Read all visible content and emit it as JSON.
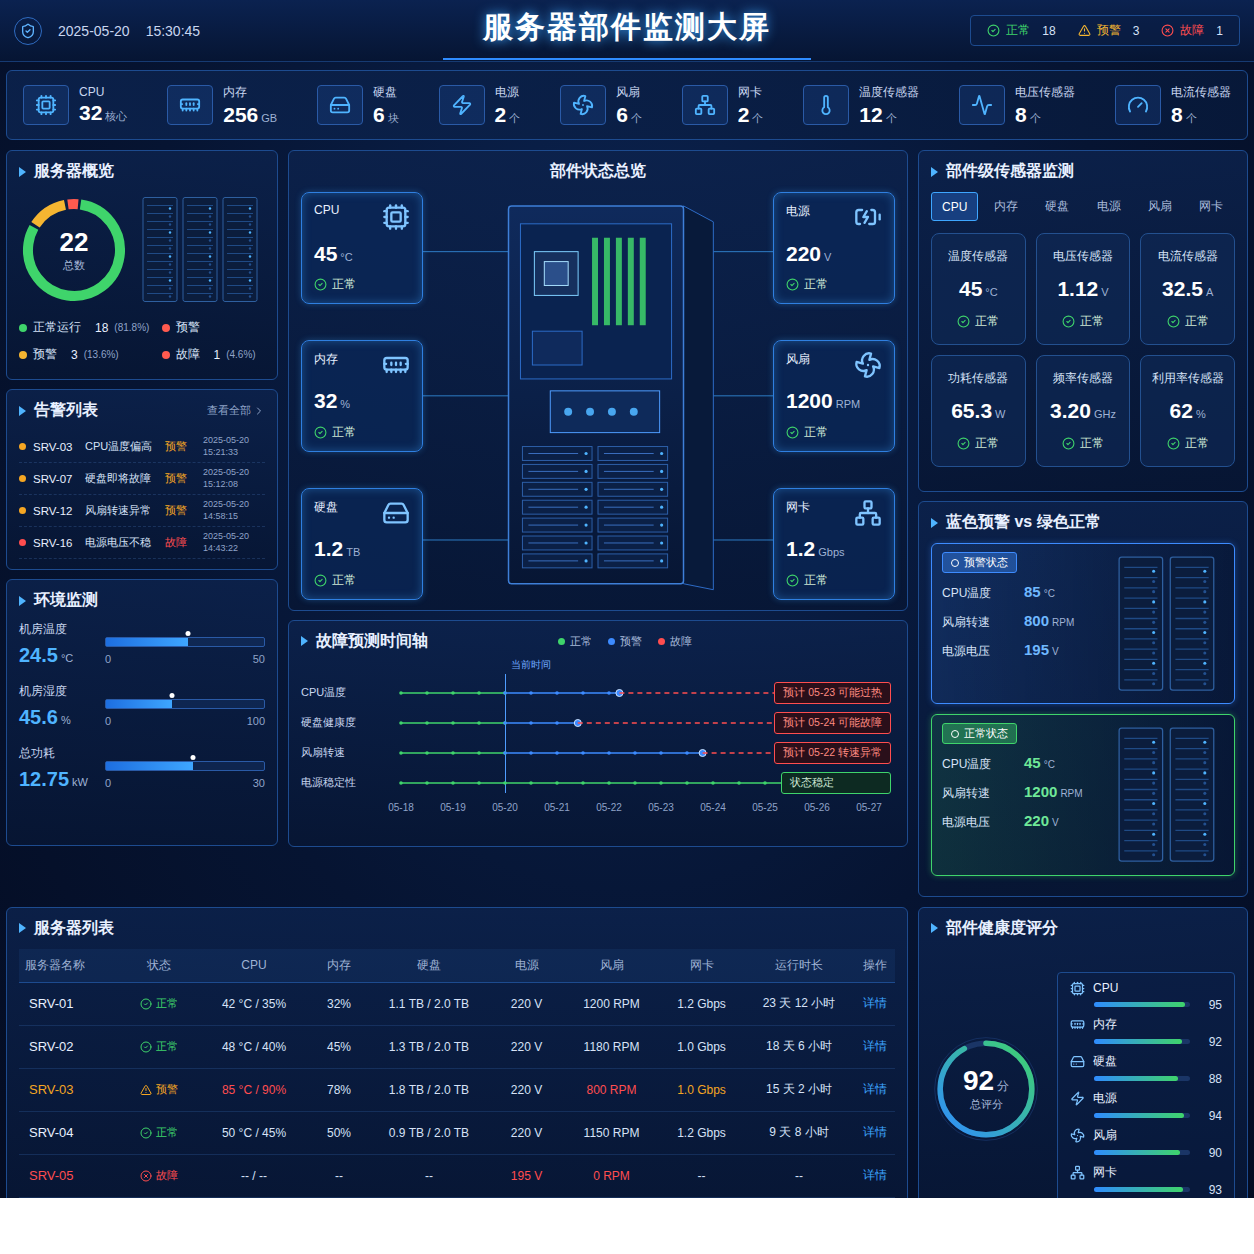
{
  "header": {
    "date": "2025-05-20",
    "time": "15:30:45",
    "title": "服务器部件监测大屏",
    "status": [
      {
        "label": "正常",
        "count": "18",
        "kind": "normal",
        "color": "#3fd46b"
      },
      {
        "label": "预警",
        "count": "3",
        "kind": "warning",
        "color": "#f5b531"
      },
      {
        "label": "故障",
        "count": "1",
        "kind": "fault",
        "color": "#ff4d4f"
      }
    ]
  },
  "stats": [
    {
      "kind": "cpu",
      "label": "CPU",
      "value": "32",
      "unit": "核心"
    },
    {
      "kind": "memory",
      "label": "内存",
      "value": "256",
      "unit": "GB"
    },
    {
      "kind": "disk",
      "label": "硬盘",
      "value": "6",
      "unit": "块"
    },
    {
      "kind": "power",
      "label": "电源",
      "value": "2",
      "unit": "个"
    },
    {
      "kind": "fan",
      "label": "风扇",
      "value": "6",
      "unit": "个"
    },
    {
      "kind": "nic",
      "label": "网卡",
      "value": "2",
      "unit": "个"
    },
    {
      "kind": "temp",
      "label": "温度传感器",
      "value": "12",
      "unit": "个"
    },
    {
      "kind": "volt",
      "label": "电压传感器",
      "value": "8",
      "unit": "个"
    },
    {
      "kind": "current",
      "label": "电流传感器",
      "value": "8",
      "unit": "个"
    }
  ],
  "overview": {
    "title": "服务器概览",
    "total": "22",
    "total_label": "总数",
    "segments": [
      {
        "value": 18,
        "color": "#3fd46b"
      },
      {
        "value": 3,
        "color": "#f5b531"
      },
      {
        "value": 1,
        "color": "#ff5a4f"
      }
    ],
    "legend": [
      {
        "label": "正常运行",
        "count": "18",
        "pct": "(81.8%)",
        "color": "#3fd46b"
      },
      {
        "label": "预警",
        "color": "#ff5a4f"
      },
      {
        "label": "预警",
        "count": "3",
        "pct": "(13.6%)",
        "color": "#f5b531"
      },
      {
        "label": "故障",
        "count": "1",
        "pct": "(4.6%)",
        "color": "#ff5a4f"
      }
    ]
  },
  "alarms": {
    "title": "告警列表",
    "view_all": "查看全部",
    "items": [
      {
        "server": "SRV-03",
        "message": "CPU温度偏高",
        "level": "预警",
        "date": "2025-05-20",
        "time": "15:21:33",
        "color": "#f5a623"
      },
      {
        "server": "SRV-07",
        "message": "硬盘即将故障",
        "level": "预警",
        "date": "2025-05-20",
        "time": "15:12:08",
        "color": "#f5a623"
      },
      {
        "server": "SRV-12",
        "message": "风扇转速异常",
        "level": "预警",
        "date": "2025-05-20",
        "time": "14:58:15",
        "color": "#f5a623"
      },
      {
        "server": "SRV-16",
        "message": "电源电压不稳",
        "level": "故障",
        "date": "2025-05-20",
        "time": "14:43:22",
        "color": "#ff4d4f"
      }
    ]
  },
  "environment": {
    "title": "环境监测",
    "items": [
      {
        "label": "机房温度",
        "value": "24.5",
        "unit": "°C",
        "min": "0",
        "max": "50",
        "level": 0.52
      },
      {
        "label": "机房湿度",
        "value": "45.6",
        "unit": "%",
        "min": "0",
        "max": "100",
        "level": 0.42
      },
      {
        "label": "总功耗",
        "value": "12.75",
        "unit": "kW",
        "min": "0",
        "max": "30",
        "level": 0.55
      }
    ]
  },
  "components": {
    "title": "部件状态总览",
    "left": [
      {
        "kind": "cpu",
        "label": "CPU",
        "value": "45",
        "unit": "°C",
        "status": "正常"
      },
      {
        "kind": "memory",
        "label": "内存",
        "value": "32",
        "unit": "%",
        "status": "正常"
      },
      {
        "kind": "disk",
        "label": "硬盘",
        "value": "1.2",
        "unit": "TB",
        "status": "正常"
      }
    ],
    "right": [
      {
        "kind": "battery",
        "label": "电源",
        "value": "220",
        "unit": "V",
        "status": "正常"
      },
      {
        "kind": "fan",
        "label": "风扇",
        "value": "1200",
        "unit": "RPM",
        "status": "正常"
      },
      {
        "kind": "nic",
        "label": "网卡",
        "value": "1.2",
        "unit": "Gbps",
        "status": "正常"
      }
    ]
  },
  "timeline": {
    "title": "故障预测时间轴",
    "legend": [
      {
        "label": "正常",
        "state": "normal",
        "color": "#3fd46b"
      },
      {
        "label": "预警",
        "state": "warning",
        "color": "#3d8bff"
      },
      {
        "label": "故障",
        "state": "fault",
        "color": "#ff4d4f"
      }
    ],
    "current_label": "当前时间",
    "current_index": 2,
    "dates": [
      "05-18",
      "05-19",
      "05-20",
      "05-21",
      "05-22",
      "05-23",
      "05-24",
      "05-25",
      "05-26",
      "05-27"
    ],
    "rows": [
      {
        "label": "CPU温度",
        "segments": [
          {
            "state": "normal",
            "from": 0,
            "to": 2
          },
          {
            "state": "warning",
            "from": 2,
            "to": 4.2
          },
          {
            "state": "fault",
            "from": 4.2,
            "to": 7.5
          }
        ],
        "tag": {
          "text": "预计 05-23 可能过热",
          "state": "fault"
        }
      },
      {
        "label": "硬盘健康度",
        "segments": [
          {
            "state": "normal",
            "from": 0,
            "to": 2
          },
          {
            "state": "warning",
            "from": 2,
            "to": 3.4
          },
          {
            "state": "fault",
            "from": 3.4,
            "to": 7.5
          }
        ],
        "tag": {
          "text": "预计 05-24 可能故障",
          "state": "fault"
        }
      },
      {
        "label": "风扇转速",
        "segments": [
          {
            "state": "normal",
            "from": 0,
            "to": 2
          },
          {
            "state": "warning",
            "from": 2,
            "to": 5.8
          },
          {
            "state": "fault",
            "from": 5.8,
            "to": 7.5
          }
        ],
        "tag": {
          "text": "预计 05-22 转速异常",
          "state": "fault"
        }
      },
      {
        "label": "电源稳定性",
        "segments": [
          {
            "state": "normal",
            "from": 0,
            "to": 7.5
          }
        ],
        "tag": {
          "text": "状态稳定",
          "state": "normal"
        }
      }
    ]
  },
  "sensors": {
    "title": "部件级传感器监测",
    "tabs": [
      {
        "label": "CPU",
        "selected": true
      },
      {
        "label": "内存",
        "selected": false
      },
      {
        "label": "硬盘",
        "selected": false
      },
      {
        "label": "电源",
        "selected": false
      },
      {
        "label": "风扇",
        "selected": false
      },
      {
        "label": "网卡",
        "selected": false
      }
    ],
    "cards": [
      {
        "label": "温度传感器",
        "value": "45",
        "unit": "°C",
        "status": "正常"
      },
      {
        "label": "电压传感器",
        "value": "1.12",
        "unit": "V",
        "status": "正常"
      },
      {
        "label": "电流传感器",
        "value": "32.5",
        "unit": "A",
        "status": "正常"
      },
      {
        "label": "功耗传感器",
        "value": "65.3",
        "unit": "W",
        "status": "正常"
      },
      {
        "label": "频率传感器",
        "value": "3.20",
        "unit": "GHz",
        "status": "正常"
      },
      {
        "label": "利用率传感器",
        "value": "62",
        "unit": "%",
        "status": "正常"
      }
    ]
  },
  "compare": {
    "title": "蓝色预警 vs 绿色正常",
    "cards": [
      {
        "badge": "预警状态",
        "kind": "warning",
        "color": "#3d8bff",
        "rows": [
          {
            "label": "CPU温度",
            "value": "85",
            "unit": "°C"
          },
          {
            "label": "风扇转速",
            "value": "800",
            "unit": "RPM"
          },
          {
            "label": "电源电压",
            "value": "195",
            "unit": "V"
          }
        ]
      },
      {
        "badge": "正常状态",
        "kind": "normal",
        "color": "#3fd46b",
        "rows": [
          {
            "label": "CPU温度",
            "value": "45",
            "unit": "°C"
          },
          {
            "label": "风扇转速",
            "value": "1200",
            "unit": "RPM"
          },
          {
            "label": "电源电压",
            "value": "220",
            "unit": "V"
          }
        ]
      }
    ]
  },
  "server_list": {
    "title": "服务器列表",
    "columns": [
      "服务器名称",
      "状态",
      "CPU",
      "内存",
      "硬盘",
      "电源",
      "风扇",
      "网卡",
      "运行时长",
      "操作"
    ],
    "rows": [
      {
        "name": "SRV-01",
        "tone": "normal",
        "status": "正常",
        "action": "详情",
        "cells": [
          {
            "text": "42 °C / 35%",
            "tone": "normal"
          },
          {
            "text": "32%",
            "tone": "normal"
          },
          {
            "text": "1.1 TB / 2.0 TB",
            "tone": "normal"
          },
          {
            "text": "220 V",
            "tone": "normal"
          },
          {
            "text": "1200 RPM",
            "tone": "normal"
          },
          {
            "text": "1.2 Gbps",
            "tone": "normal"
          },
          {
            "text": "23 天 12 小时",
            "tone": "normal"
          }
        ]
      },
      {
        "name": "SRV-02",
        "tone": "normal",
        "status": "正常",
        "action": "详情",
        "cells": [
          {
            "text": "48 °C / 40%",
            "tone": "normal"
          },
          {
            "text": "45%",
            "tone": "normal"
          },
          {
            "text": "1.3 TB / 2.0 TB",
            "tone": "normal"
          },
          {
            "text": "220 V",
            "tone": "normal"
          },
          {
            "text": "1180 RPM",
            "tone": "normal"
          },
          {
            "text": "1.0 Gbps",
            "tone": "normal"
          },
          {
            "text": "18 天 6 小时",
            "tone": "normal"
          }
        ]
      },
      {
        "name": "SRV-03",
        "tone": "warning",
        "status": "预警",
        "action": "详情",
        "cells": [
          {
            "text": "85 °C / 90%",
            "tone": "fault"
          },
          {
            "text": "78%",
            "tone": "normal"
          },
          {
            "text": "1.8 TB / 2.0 TB",
            "tone": "normal"
          },
          {
            "text": "220 V",
            "tone": "normal"
          },
          {
            "text": "800 RPM",
            "tone": "fault"
          },
          {
            "text": "1.0 Gbps",
            "tone": "warning"
          },
          {
            "text": "15 天 2 小时",
            "tone": "normal"
          }
        ]
      },
      {
        "name": "SRV-04",
        "tone": "normal",
        "status": "正常",
        "action": "详情",
        "cells": [
          {
            "text": "50 °C / 45%",
            "tone": "normal"
          },
          {
            "text": "50%",
            "tone": "normal"
          },
          {
            "text": "0.9 TB / 2.0 TB",
            "tone": "normal"
          },
          {
            "text": "220 V",
            "tone": "normal"
          },
          {
            "text": "1150 RPM",
            "tone": "normal"
          },
          {
            "text": "1.2 Gbps",
            "tone": "normal"
          },
          {
            "text": "9 天 8 小时",
            "tone": "normal"
          }
        ]
      },
      {
        "name": "SRV-05",
        "tone": "fault",
        "status": "故障",
        "action": "详情",
        "cells": [
          {
            "text": "-- / --",
            "tone": "normal"
          },
          {
            "text": "--",
            "tone": "normal"
          },
          {
            "text": "--",
            "tone": "normal"
          },
          {
            "text": "195 V",
            "tone": "fault"
          },
          {
            "text": "0 RPM",
            "tone": "fault"
          },
          {
            "text": "--",
            "tone": "normal"
          },
          {
            "text": "--",
            "tone": "normal"
          }
        ]
      }
    ]
  },
  "health": {
    "title": "部件健康度评分",
    "score": "92",
    "unit": "分",
    "label": "总评分",
    "level": 0.92,
    "items": [
      {
        "kind": "cpu",
        "label": "CPU",
        "score": "95",
        "level": 0.95
      },
      {
        "kind": "memory",
        "label": "内存",
        "score": "92",
        "level": 0.92
      },
      {
        "kind": "disk",
        "label": "硬盘",
        "score": "88",
        "level": 0.88
      },
      {
        "kind": "power",
        "label": "电源",
        "score": "94",
        "level": 0.94
      },
      {
        "kind": "fan",
        "label": "风扇",
        "score": "90",
        "level": 0.9
      },
      {
        "kind": "nic",
        "label": "网卡",
        "score": "93",
        "level": 0.93
      }
    ]
  }
}
